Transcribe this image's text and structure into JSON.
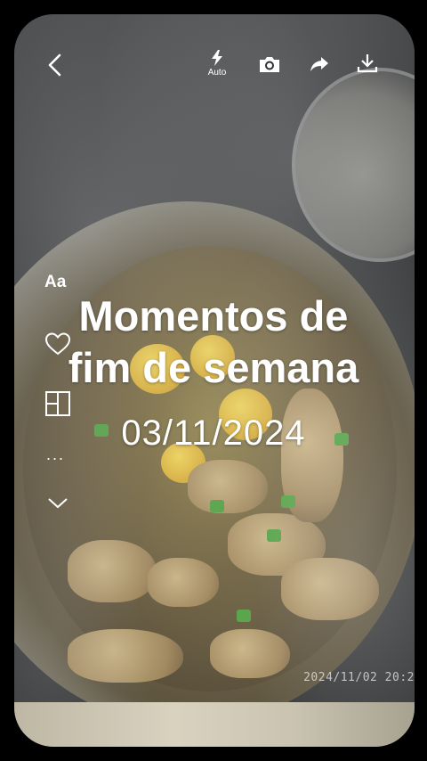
{
  "topbar": {
    "back_icon": "chevron-left-icon",
    "flash_icon": "flash-icon",
    "flash_mode": "Auto",
    "camera_icon": "camera-icon",
    "share_icon": "share-icon",
    "download_icon": "download-icon"
  },
  "tools": {
    "text_tool": "Aa",
    "heart_icon": "heart-icon",
    "layout_icon": "layout-grid-icon",
    "more": "...",
    "expand_icon": "chevron-down-icon"
  },
  "overlay": {
    "title_line1": "Momentos de",
    "title_line2": "fim de semana",
    "date": "03/11/2024"
  },
  "photo": {
    "timestamp": "2024/11/02  20:2"
  },
  "colors": {
    "background": "#000000",
    "text": "#ffffff"
  }
}
